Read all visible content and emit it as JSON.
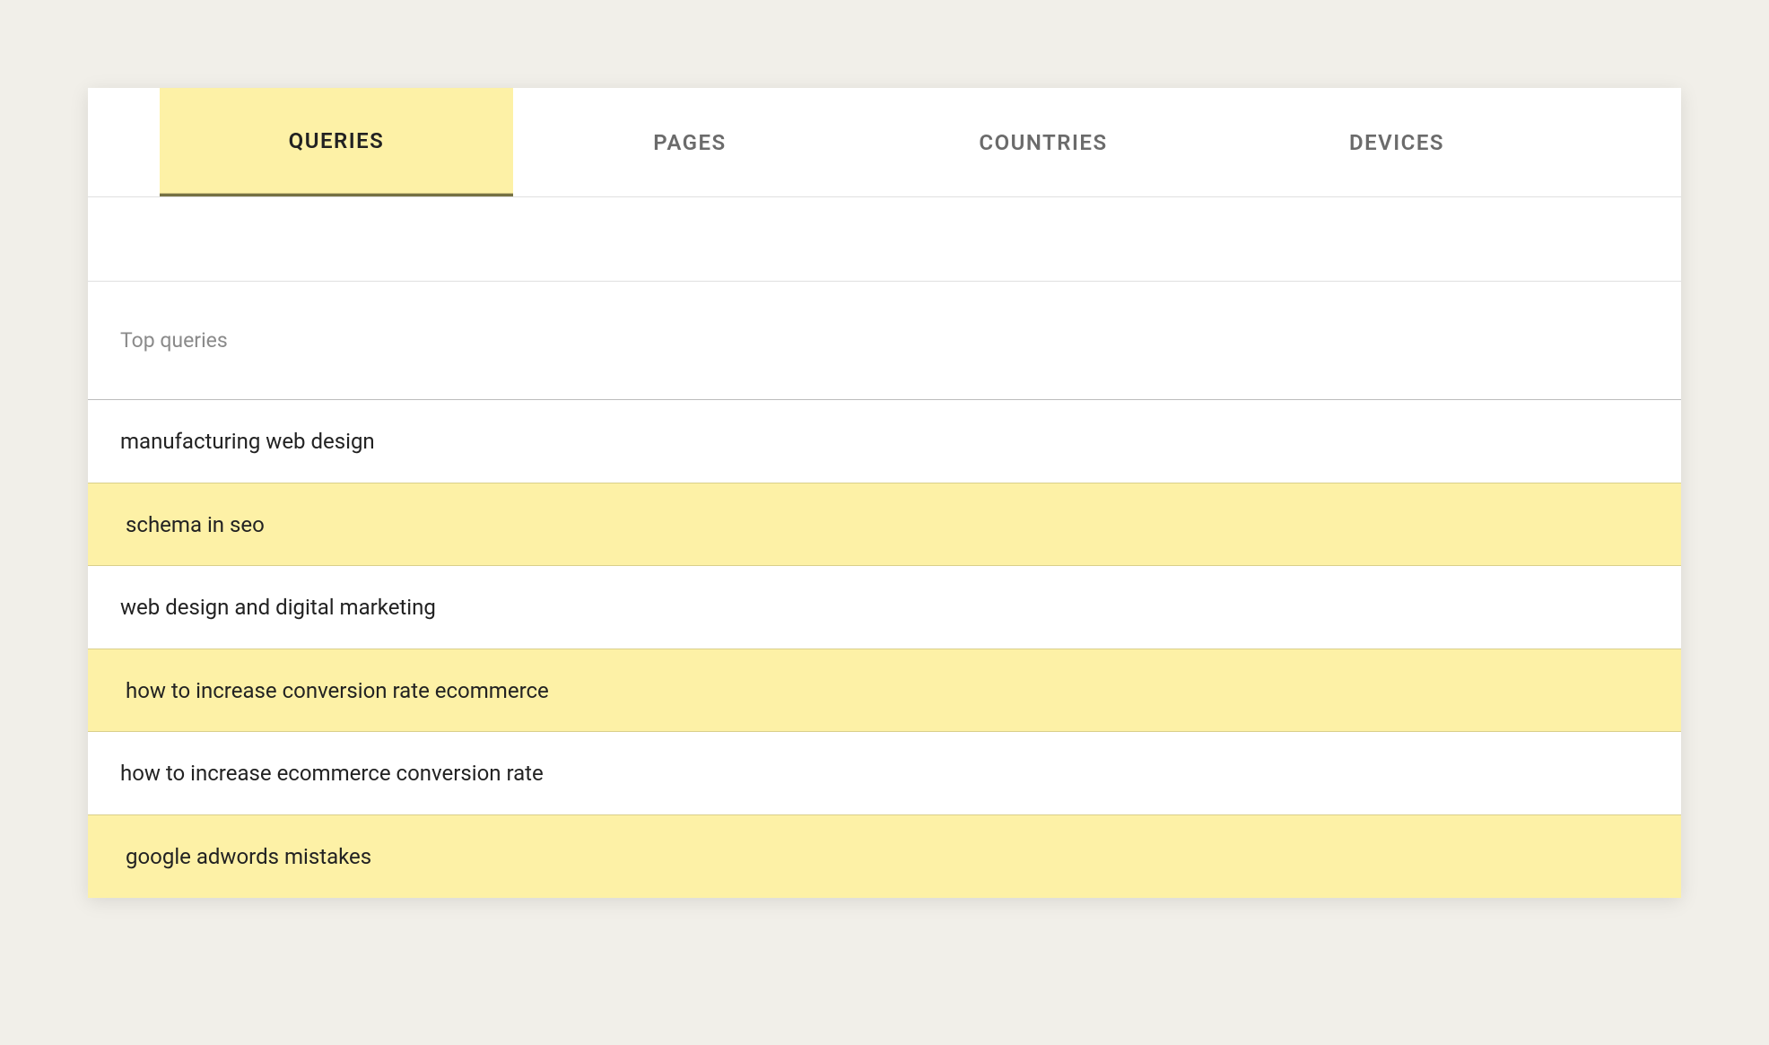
{
  "tabs": [
    {
      "label": "QUERIES",
      "active": true
    },
    {
      "label": "PAGES",
      "active": false
    },
    {
      "label": "COUNTRIES",
      "active": false
    },
    {
      "label": "DEVICES",
      "active": false
    }
  ],
  "section": {
    "header": "Top queries"
  },
  "queries": [
    {
      "text": "manufacturing web design",
      "highlight": false
    },
    {
      "text": "schema in seo",
      "highlight": true
    },
    {
      "text": "web design and digital marketing",
      "highlight": false
    },
    {
      "text": "how to increase conversion rate ecommerce",
      "highlight": true
    },
    {
      "text": "how to increase ecommerce conversion rate",
      "highlight": false
    },
    {
      "text": "google adwords mistakes",
      "highlight": true
    }
  ]
}
